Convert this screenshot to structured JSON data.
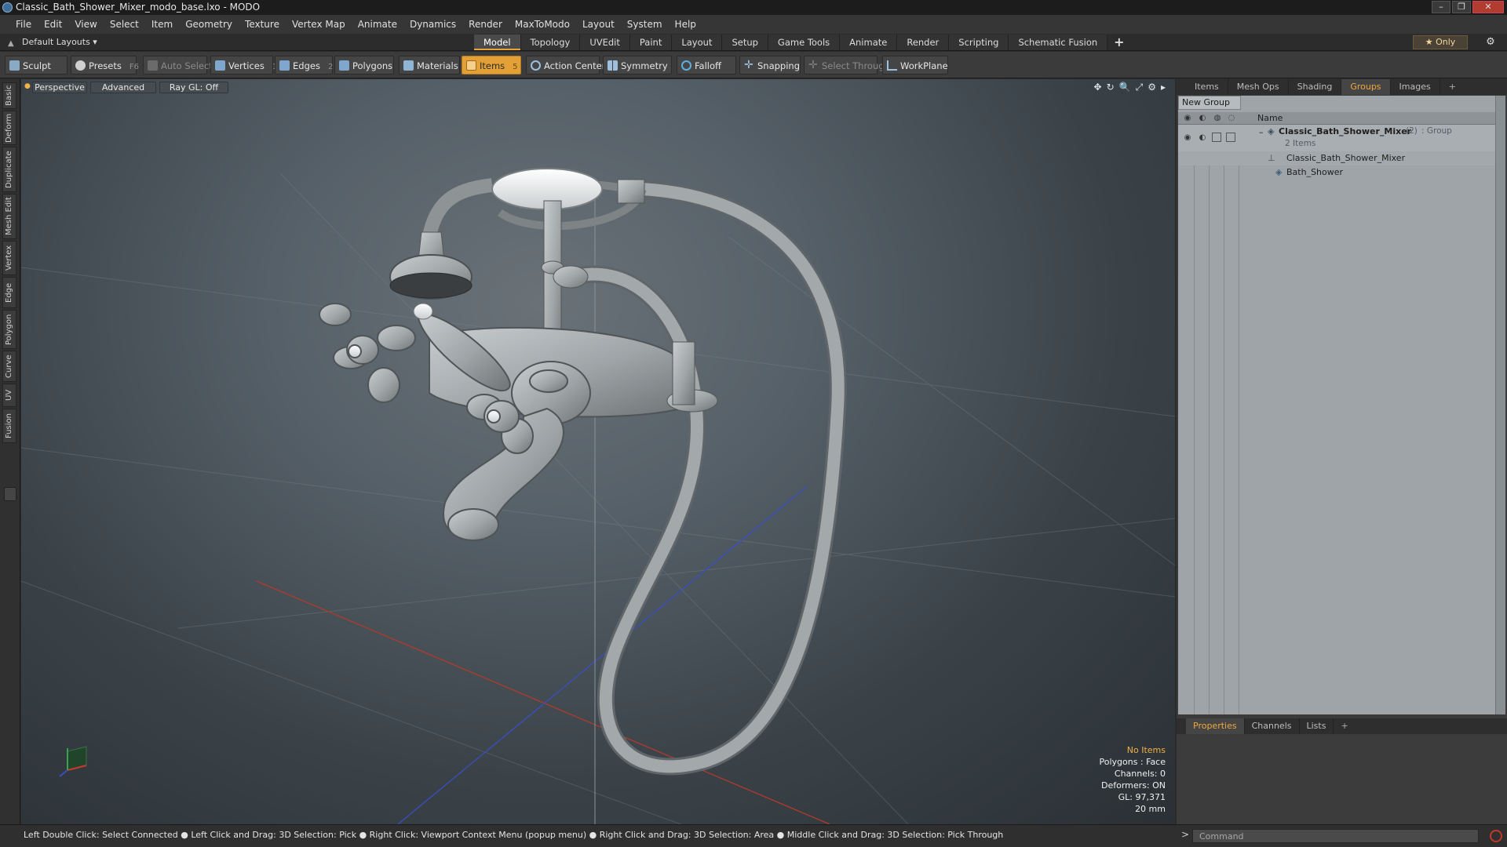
{
  "window": {
    "title": "Classic_Bath_Shower_Mixer_modo_base.lxo - MODO",
    "controls": [
      "–",
      "❐",
      "✕"
    ]
  },
  "menu": [
    "File",
    "Edit",
    "View",
    "Select",
    "Item",
    "Geometry",
    "Texture",
    "Vertex Map",
    "Animate",
    "Dynamics",
    "Render",
    "MaxToModo",
    "Layout",
    "System",
    "Help"
  ],
  "layout": {
    "menu_label": "Default Layouts ▾",
    "tabs": [
      "Model",
      "Topology",
      "UVEdit",
      "Paint",
      "Layout",
      "Setup",
      "Game Tools",
      "Animate",
      "Render",
      "Scripting",
      "Schematic Fusion"
    ],
    "active_tab": "Model",
    "plus": "+",
    "only_label": "★  Only",
    "gear": "⚙"
  },
  "toolbar": {
    "sculpt": "Sculpt",
    "presets": "Presets",
    "presets_key": "F6",
    "auto_select": "Auto Select",
    "vertices": "Vertices",
    "vertices_count": "1",
    "edges": "Edges",
    "edges_count": "2",
    "polygons": "Polygons",
    "materials": "Materials",
    "items": "Items",
    "items_count": "5",
    "action_center": "Action Center",
    "symmetry": "Symmetry",
    "falloff": "Falloff",
    "snapping": "Snapping",
    "select_through": "Select Through",
    "workplane": "WorkPlane"
  },
  "left_tabs": [
    "Basic",
    "Deform",
    "Duplicate",
    "Mesh Edit",
    "Vertex",
    "Edge",
    "Polygon",
    "Curve",
    "UV",
    "Fusion"
  ],
  "viewport": {
    "perspective": "Perspective",
    "advanced": "Advanced",
    "raygl": "Ray GL: Off",
    "icons": [
      "✥",
      "↻",
      "🔍",
      "⤢",
      "⚙",
      "▸"
    ],
    "stats": {
      "no_items": "No Items",
      "polygons": "Polygons : Face",
      "channels": "Channels: 0",
      "deformers": "Deformers: ON",
      "gl": "GL: 97,371",
      "scale": "20 mm"
    }
  },
  "right_panel": {
    "tabs": [
      "Items",
      "Mesh Ops",
      "Shading",
      "Groups",
      "Images"
    ],
    "active_tab": "Groups",
    "plus": "+",
    "new_group": "New Group",
    "column_name": "Name",
    "group": {
      "name": "Classic_Bath_Shower_Mixer",
      "count": "(2)",
      "type": ": Group",
      "items_label": "2 Items",
      "children": [
        "Classic_Bath_Shower_Mixer",
        "Bath_Shower"
      ]
    },
    "bottom_tabs": [
      "Properties",
      "Channels",
      "Lists"
    ],
    "bottom_active": "Properties"
  },
  "statusbar": {
    "text": "Left Double Click: Select Connected ● Left Click and Drag: 3D Selection: Pick ● Right Click: Viewport Context Menu (popup menu) ● Right Click and Drag: 3D Selection: Area ● Middle Click and Drag: 3D Selection: Pick Through"
  },
  "command": {
    "placeholder": "Command",
    "arrow": ">"
  },
  "colors": {
    "accent": "#e3a036",
    "viewport_bg": "#566068",
    "group_panel": "#9ea4a8"
  }
}
